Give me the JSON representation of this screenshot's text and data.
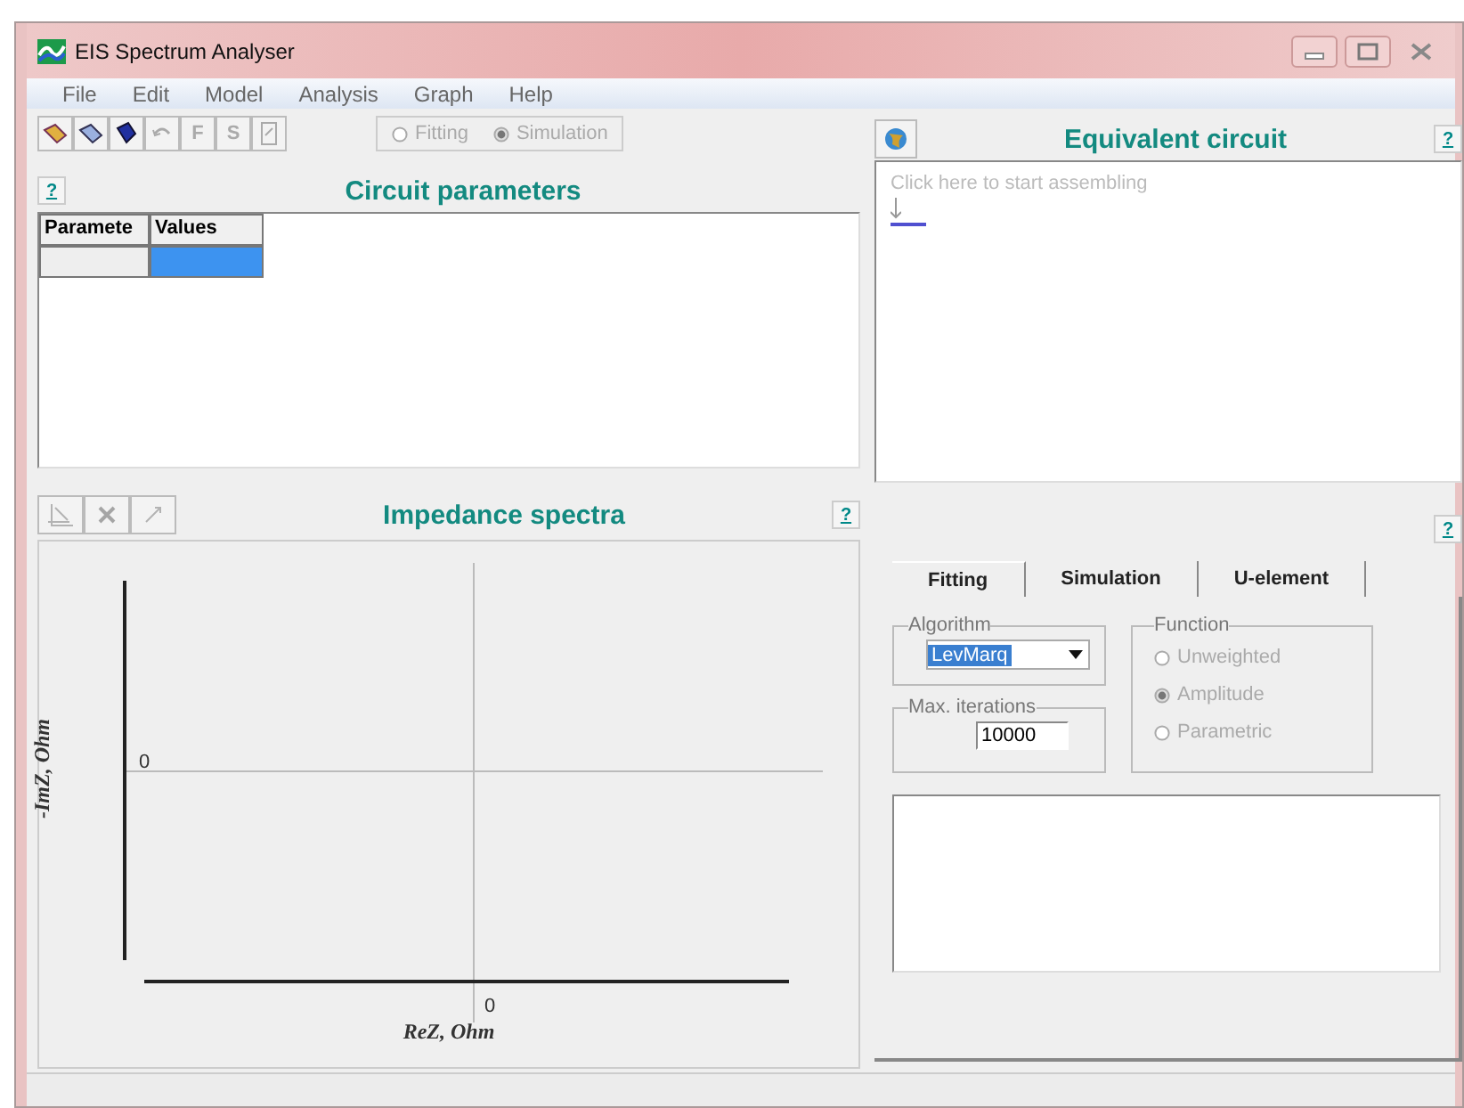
{
  "window": {
    "title": "EIS Spectrum Analyser"
  },
  "menu": [
    {
      "label": "File"
    },
    {
      "label": "Edit"
    },
    {
      "label": "Model"
    },
    {
      "label": "Analysis"
    },
    {
      "label": "Graph"
    },
    {
      "label": "Help"
    }
  ],
  "toolbar_letters": [
    "F",
    "S"
  ],
  "mode": {
    "disabled": true,
    "options": [
      {
        "label": "Fitting",
        "selected": false
      },
      {
        "label": "Simulation",
        "selected": true
      }
    ]
  },
  "circuit_parameters": {
    "title": "Circuit parameters",
    "help": "?",
    "columns": [
      "Paramete",
      "Values"
    ],
    "rows": [
      {
        "cells": [
          {
            "selected": false
          },
          {
            "selected": true
          }
        ]
      }
    ]
  },
  "equivalent_circuit": {
    "title": "Equivalent circuit",
    "help": "?",
    "hint": "Click here to start assembling"
  },
  "impedance_spectra": {
    "title": "Impedance spectra",
    "help": "?",
    "tools_disabled": true,
    "plot": {
      "xlabel": "ReZ, Ohm",
      "ylabel": "-ImZ, Ohm",
      "x_tick": "0",
      "y_tick": "0"
    }
  },
  "fitting_panel": {
    "help": "?",
    "tabs": [
      {
        "label": "Fitting",
        "selected": true
      },
      {
        "label": "Simulation",
        "selected": false
      },
      {
        "label": "U-element",
        "selected": false
      }
    ],
    "algorithm": {
      "legend": "Algorithm",
      "value": "LevMarq"
    },
    "iterations": {
      "legend": "Max. iterations",
      "value": "10000"
    },
    "function": {
      "legend": "Function",
      "disabled": true,
      "options": [
        {
          "label": "Unweighted",
          "selected": false
        },
        {
          "label": "Amplitude",
          "selected": true
        },
        {
          "label": "Parametric",
          "selected": false
        }
      ]
    }
  }
}
